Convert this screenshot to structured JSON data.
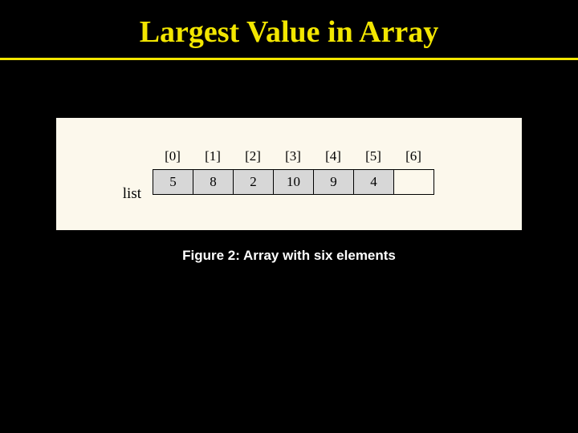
{
  "title": "Largest Value in Array",
  "caption": "Figure 2: Array with six elements",
  "array": {
    "label": "list",
    "indices": [
      "[0]",
      "[1]",
      "[2]",
      "[3]",
      "[4]",
      "[5]",
      "[6]"
    ],
    "values": [
      "5",
      "8",
      "2",
      "10",
      "9",
      "4",
      ""
    ]
  }
}
